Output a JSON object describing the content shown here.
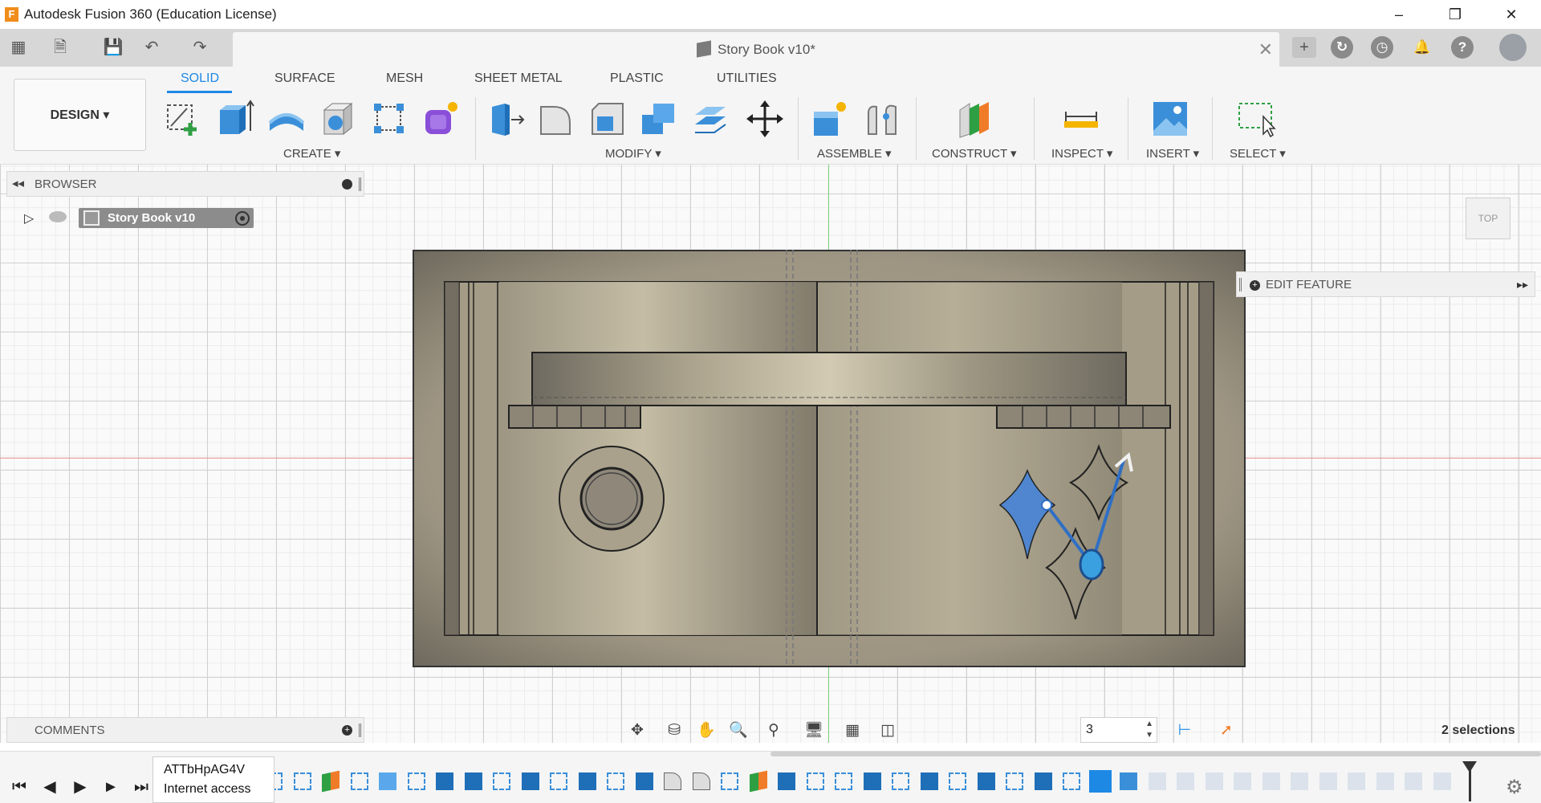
{
  "window": {
    "title": "Autodesk Fusion 360 (Education License)",
    "logo_letter": "F"
  },
  "document": {
    "tab_title": "Story Book v10*"
  },
  "workspace": {
    "design_label": "DESIGN ▾",
    "tabs": [
      {
        "label": "SOLID",
        "active": true
      },
      {
        "label": "SURFACE"
      },
      {
        "label": "MESH"
      },
      {
        "label": "SHEET METAL"
      },
      {
        "label": "PLASTIC"
      },
      {
        "label": "UTILITIES"
      }
    ]
  },
  "toolbar_groups": {
    "create": "CREATE ▾",
    "modify": "MODIFY ▾",
    "assemble": "ASSEMBLE ▾",
    "construct": "CONSTRUCT ▾",
    "inspect": "INSPECT ▾",
    "insert": "INSERT ▾",
    "select": "SELECT ▾"
  },
  "browser": {
    "title": "BROWSER",
    "root_item": "Story Book v10"
  },
  "comments": {
    "title": "COMMENTS"
  },
  "edit_feature": {
    "label": "EDIT FEATURE"
  },
  "viewcube": {
    "face": "TOP"
  },
  "status": {
    "stepper_value": "3",
    "selections": "2 selections"
  },
  "tooltip": {
    "line1": "ATTbHpAG4V",
    "line2": "Internet access"
  },
  "colors": {
    "accent": "#1e88e5",
    "model_face": "#a8a08a",
    "axis_red": "#e98f8f",
    "axis_green": "#7ed17e"
  }
}
